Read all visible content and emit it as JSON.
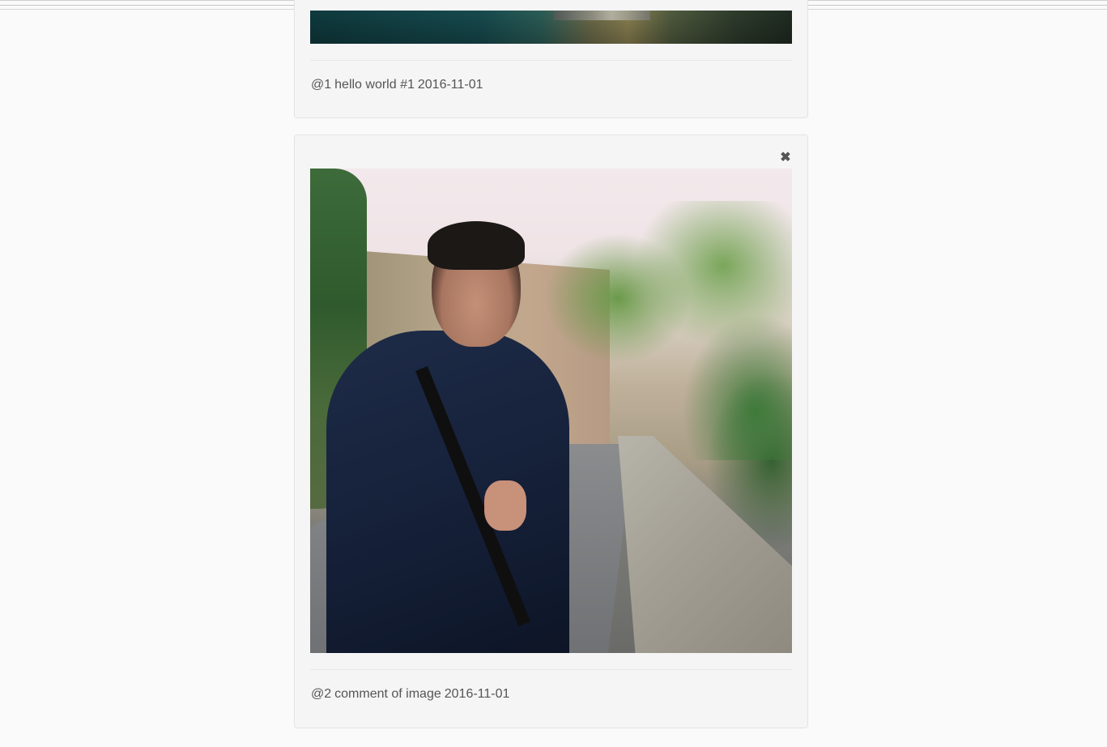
{
  "posts": [
    {
      "user_tag": "@1",
      "text": "hello world #1",
      "date": "2016-11-01",
      "image_icon": "landscape-photo"
    },
    {
      "user_tag": "@2",
      "text": "comment of image",
      "date": "2016-11-01",
      "image_icon": "portrait-photo",
      "close_icon": "close-icon",
      "close_glyph": "✖"
    }
  ]
}
